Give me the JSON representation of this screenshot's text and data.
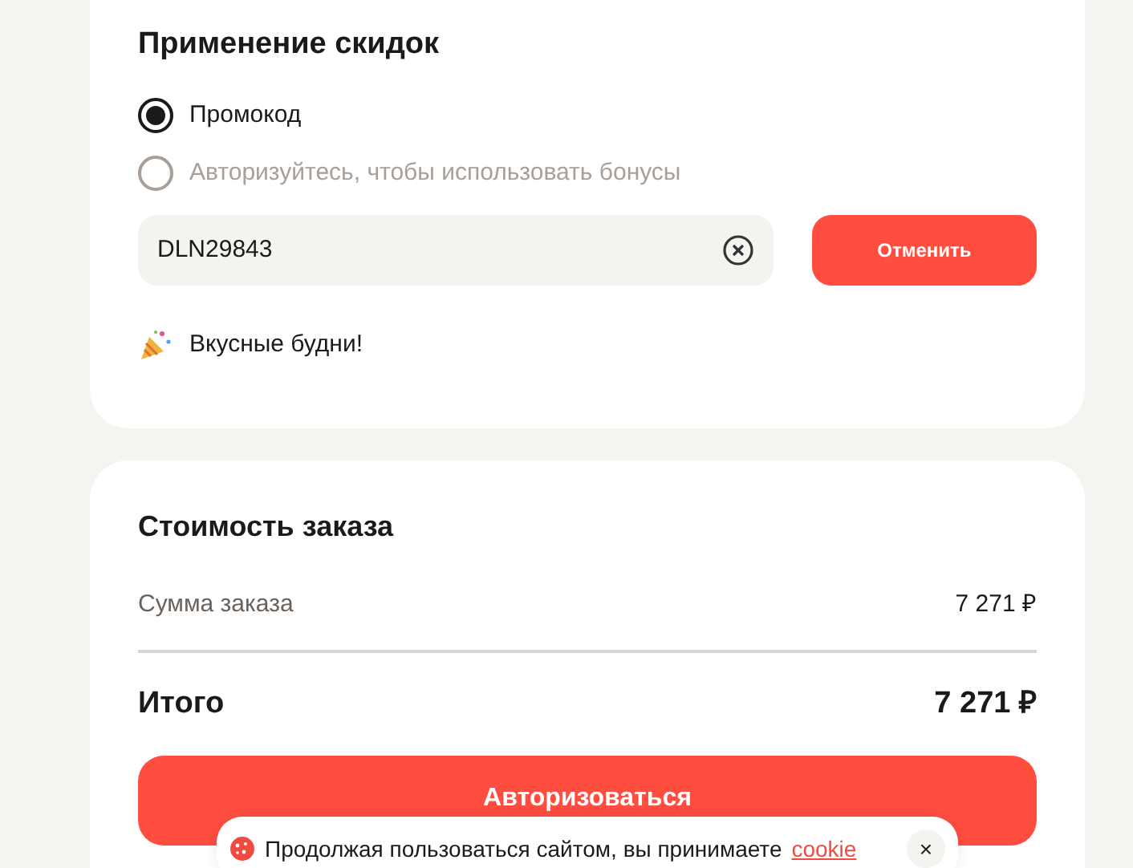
{
  "discounts": {
    "title": "Применение скидок",
    "options": [
      {
        "label": "Промокод",
        "selected": true,
        "disabled": false
      },
      {
        "label": "Авторизуйтесь, чтобы использовать бонусы",
        "selected": false,
        "disabled": true
      }
    ],
    "promo_field": {
      "value": "DLN29843"
    },
    "cancel_button": "Отменить",
    "applied_promo": "Вкусные будни!"
  },
  "order": {
    "title": "Стоимость заказа",
    "subtotal": {
      "label": "Сумма заказа",
      "value": "7 271 ₽"
    },
    "total": {
      "label": "Итого",
      "value": "7 271 ₽"
    },
    "login_button": "Авторизоваться"
  },
  "cookie_banner": {
    "text": "Продолжая пользоваться сайтом, вы принимаете",
    "link": "cookie",
    "close": "×"
  }
}
